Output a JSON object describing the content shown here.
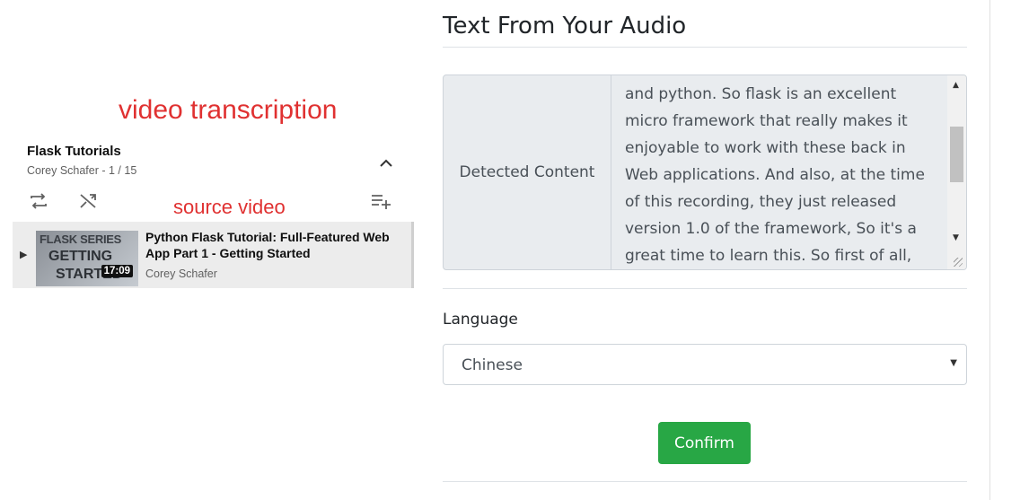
{
  "annotations": {
    "transcription_label": "video transcription",
    "source_label": "source video"
  },
  "playlist": {
    "title": "Flask Tutorials",
    "subtitle": "Corey Schafer - 1 / 15",
    "video": {
      "title": "Python Flask Tutorial: Full-Featured Web App Part 1 - Getting Started",
      "author": "Corey Schafer",
      "duration": "17:09",
      "thumb_line1": "FLASK SERIES",
      "thumb_line2": "GETTING",
      "thumb_line3": "STARTED"
    }
  },
  "panel": {
    "title": "Text From Your Audio",
    "detected_label": "Detected Content",
    "detected_text": "and python. So flask is an excellent micro framework that really makes it enjoyable to work with these back in Web applications. And also, at the time of this recording, they just released version 1.0 of the framework, So it's a great time to learn this. So first of all,",
    "language_label": "Language",
    "language_value": "Chinese",
    "confirm_label": "Confirm"
  },
  "colors": {
    "annotation_red": "#e03131",
    "confirm_green": "#28a745"
  },
  "icons": [
    "repeat-icon",
    "shuffle-icon",
    "add-to-queue-icon",
    "chevron-up-icon",
    "play-indicator-icon",
    "scroll-up-arrow-icon",
    "scroll-down-arrow-icon",
    "select-caret-icon",
    "resize-grip-icon"
  ]
}
